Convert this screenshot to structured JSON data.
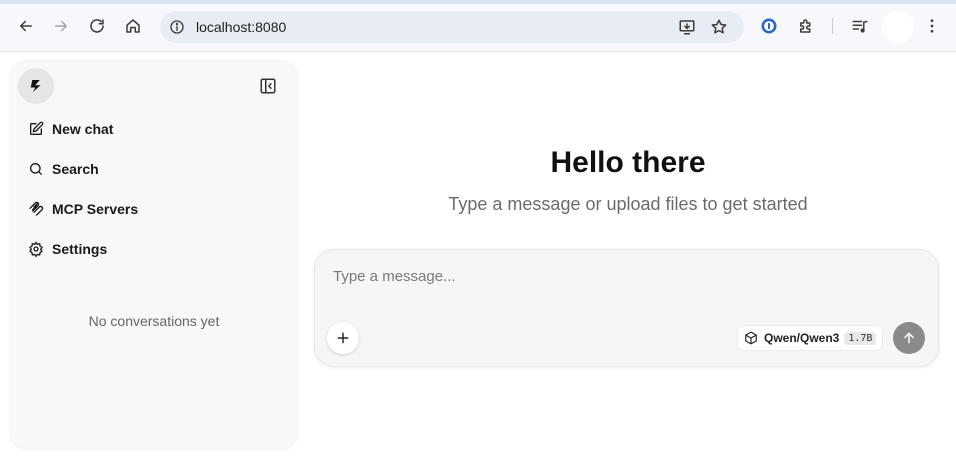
{
  "browser": {
    "url": "localhost:8080",
    "icons": {
      "back": "back-arrow-icon",
      "forward": "forward-arrow-icon",
      "reload": "reload-icon",
      "home": "home-icon",
      "site_info": "site-info-icon",
      "install": "install-app-icon",
      "bookmark": "bookmark-star-icon",
      "password_manager": "password-manager-icon",
      "extensions": "extensions-puzzle-icon",
      "media": "media-queue-icon",
      "menu": "kebab-menu-icon"
    }
  },
  "sidebar": {
    "items": [
      {
        "label": "New chat",
        "icon": "edit-icon"
      },
      {
        "label": "Search",
        "icon": "search-icon"
      },
      {
        "label": "MCP Servers",
        "icon": "mcp-icon"
      },
      {
        "label": "Settings",
        "icon": "gear-icon"
      }
    ],
    "empty_message": "No conversations yet"
  },
  "main": {
    "title": "Hello there",
    "subtitle": "Type a message or upload files to get started",
    "composer": {
      "placeholder": "Type a message...",
      "model_name": "Qwen/Qwen3",
      "model_size": "1.7B"
    }
  },
  "colors": {
    "send_button": "#8a8a8a",
    "sidebar_bg": "#f8f8f8",
    "omnibox_bg": "#e8ecf4"
  }
}
